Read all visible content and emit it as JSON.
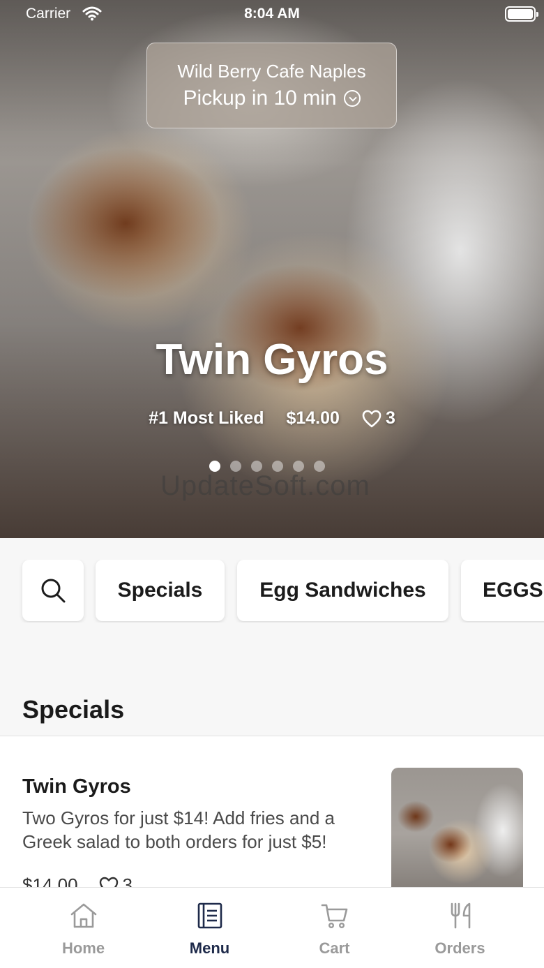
{
  "status_bar": {
    "carrier": "Carrier",
    "time": "8:04 AM"
  },
  "store": {
    "name": "Wild Berry Cafe Naples",
    "pickup": "Pickup in 10 min"
  },
  "hero": {
    "title": "Twin Gyros",
    "badge": "#1 Most Liked",
    "price": "$14.00",
    "likes": "3",
    "carousel": {
      "count": 6,
      "active": 1
    },
    "watermark": "UpdateSoft.com"
  },
  "categories": {
    "search_icon": "search-icon",
    "items": [
      "Specials",
      "Egg Sandwiches",
      "EGGS"
    ]
  },
  "section": {
    "title": "Specials"
  },
  "menu_item": {
    "name": "Twin Gyros",
    "description": "Two Gyros for just $14! Add fries and a Greek salad to both orders for just $5!",
    "price": "$14.00",
    "likes": "3"
  },
  "tab_bar": {
    "items": [
      {
        "label": "Home",
        "icon": "home-icon"
      },
      {
        "label": "Menu",
        "icon": "menu-icon"
      },
      {
        "label": "Cart",
        "icon": "cart-icon"
      },
      {
        "label": "Orders",
        "icon": "fork-knife-icon"
      }
    ],
    "active": "Menu"
  },
  "colors": {
    "active_tab": "#1e2a4a",
    "inactive_tab": "#9a9a9a",
    "background": "#f7f7f7"
  }
}
